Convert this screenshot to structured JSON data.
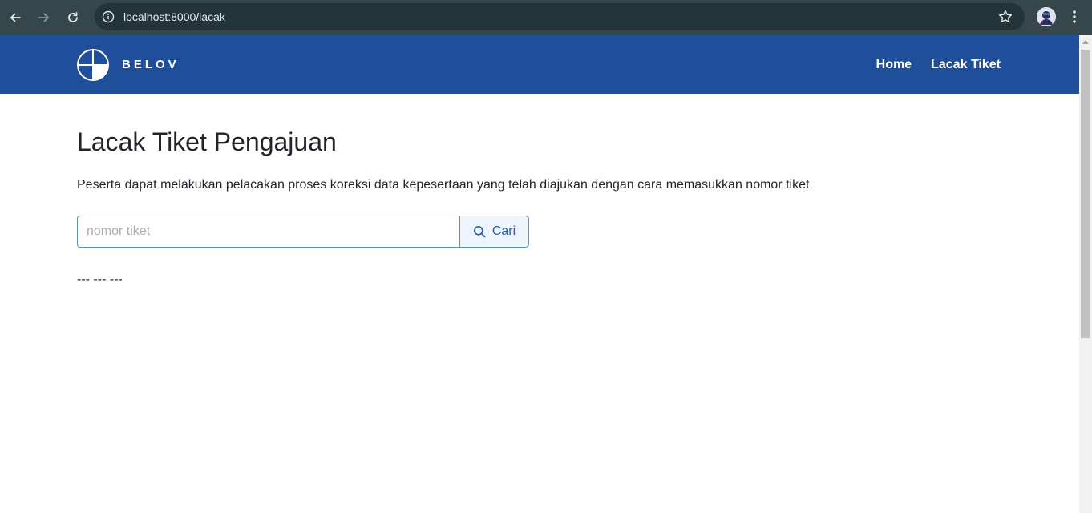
{
  "browser": {
    "url": "localhost:8000/lacak",
    "back_icon": "arrow-left-icon",
    "forward_icon": "arrow-right-icon",
    "reload_icon": "reload-icon",
    "info_icon": "info-icon",
    "bookmark_icon": "star-icon",
    "menu_icon": "kebab-menu-icon"
  },
  "navbar": {
    "brand": "BELOV",
    "links": [
      "Home",
      "Lacak Tiket"
    ],
    "background": "#1f4e9a"
  },
  "main": {
    "title": "Lacak Tiket Pengajuan",
    "description": "Peserta dapat melakukan pelacakan proses koreksi data kepesertaan yang telah diajukan dengan cara memasukkan nomor tiket",
    "search": {
      "placeholder": "nomor tiket",
      "value": "",
      "button_label": "Cari",
      "button_icon": "search-icon"
    },
    "result": "--- --- ---"
  }
}
